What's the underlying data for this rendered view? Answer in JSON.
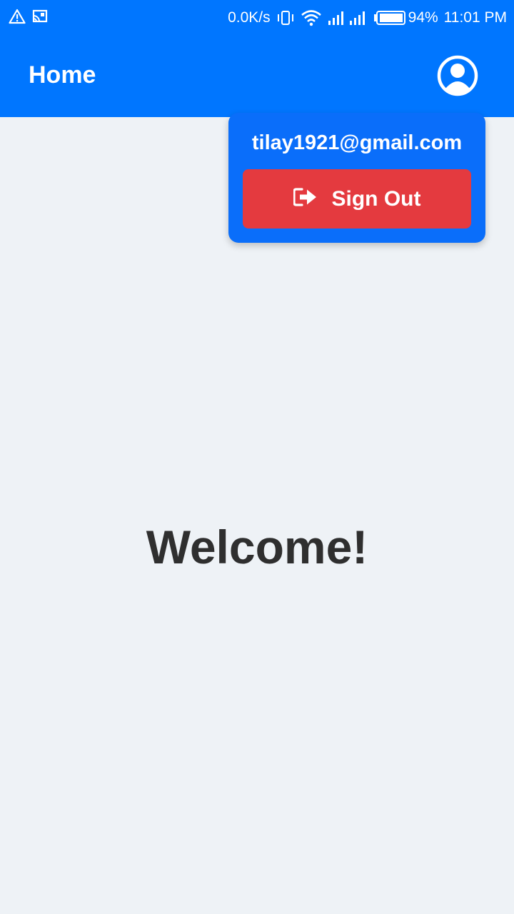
{
  "status_bar": {
    "network_speed": "0.0K/s",
    "battery_level": "94%",
    "time": "11:01 PM",
    "icons": [
      "warning-icon",
      "cast-icon",
      "vibrate-icon",
      "wifi-icon",
      "signal-icon",
      "battery-icon"
    ]
  },
  "app_bar": {
    "title": "Home",
    "profile_icon": "account-circle-icon"
  },
  "user_menu": {
    "email": "tilay1921@gmail.com",
    "sign_out_label": "Sign Out",
    "sign_out_icon": "sign-out-icon"
  },
  "main": {
    "welcome_text": "Welcome!"
  },
  "colors": {
    "primary": "#0076ff",
    "menu_background": "#0a6efa",
    "danger": "#e43a3f",
    "page_background": "#eef2f6",
    "text_dark": "#2f2f2f"
  }
}
